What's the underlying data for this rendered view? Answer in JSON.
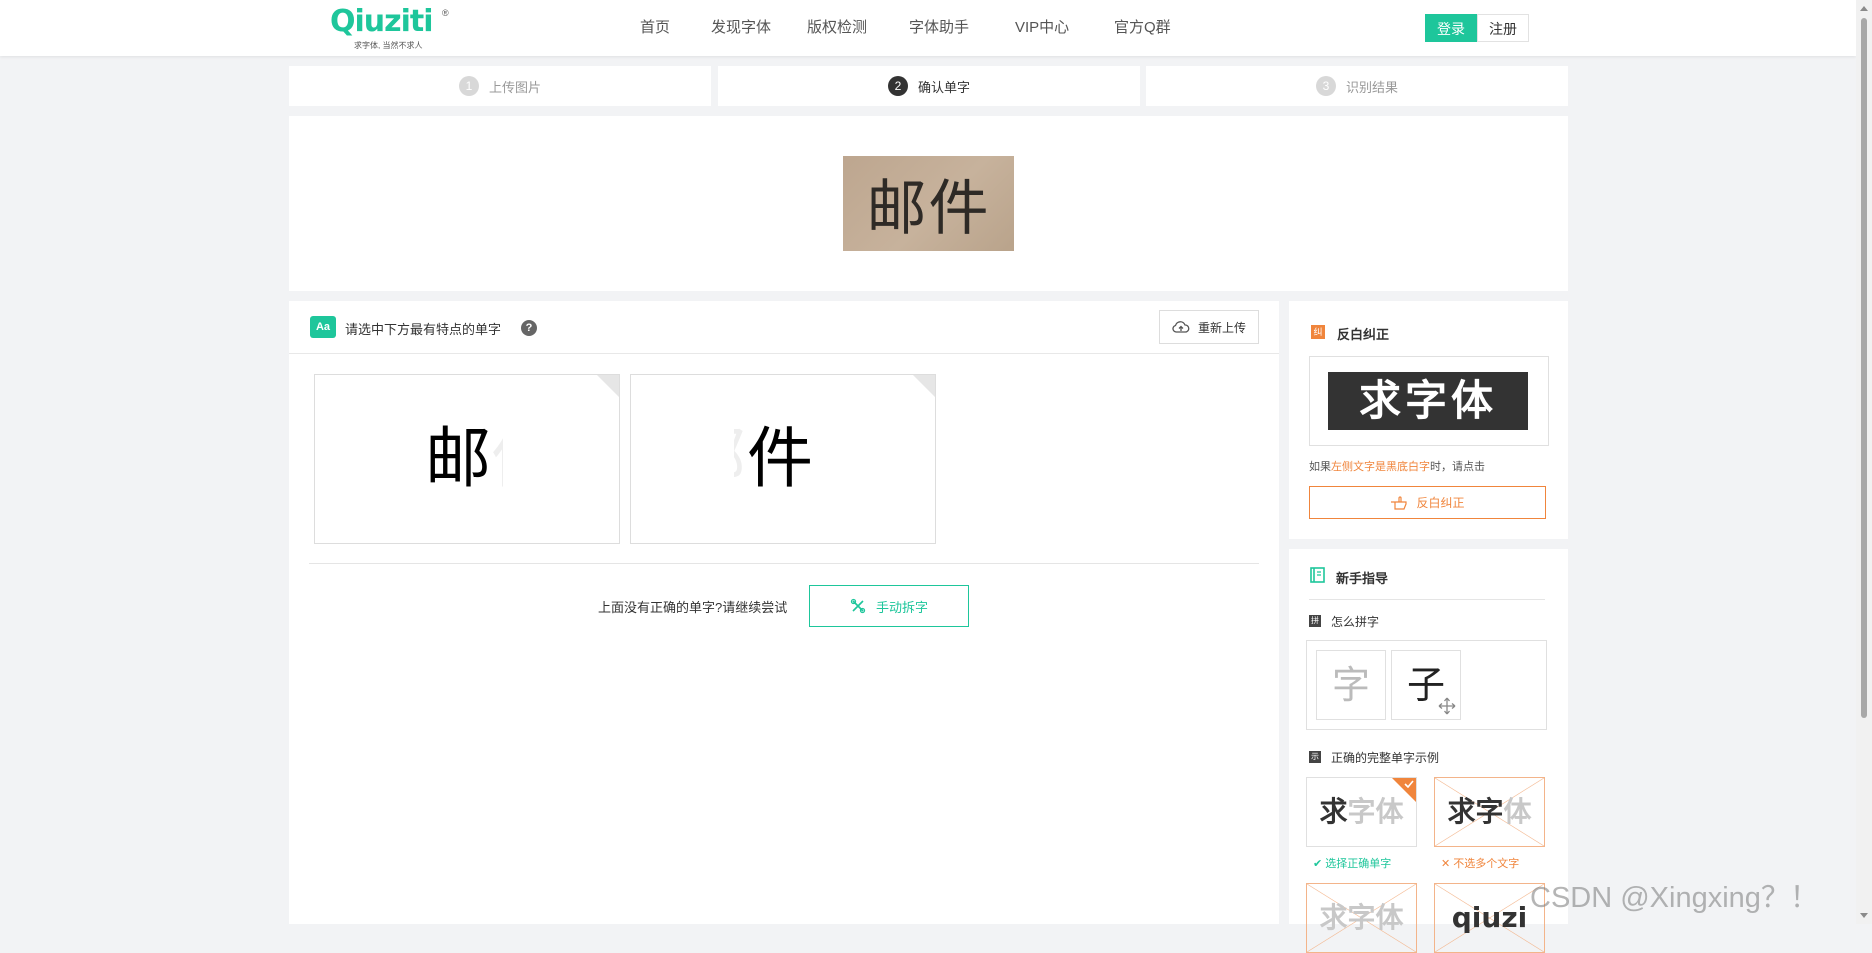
{
  "header": {
    "logo_text": "Qiuziti",
    "logo_mark": "®",
    "logo_tagline": "求字体, 当然不求人",
    "nav": [
      "首页",
      "发现字体",
      "版权检测",
      "字体助手",
      "VIP中心",
      "官方Q群"
    ],
    "login_label": "登录",
    "register_label": "注册"
  },
  "steps": [
    {
      "num": "1",
      "label": "上传图片"
    },
    {
      "num": "2",
      "label": "确认单字"
    },
    {
      "num": "3",
      "label": "识别结果"
    }
  ],
  "preview": {
    "text": "邮件"
  },
  "selection": {
    "icon_text": "Aa",
    "title": "请选中下方最有特点的单字",
    "help_text": "?",
    "reupload_label": "重新上传",
    "chars": [
      "邮",
      "件"
    ],
    "retry_text": "上面没有正确的单字?请继续尝试",
    "manual_label": "手动拆字"
  },
  "correction": {
    "icon_text": "纠",
    "title": "反白纠正",
    "demo_text": "求字体",
    "hint_prefix": "如果",
    "hint_highlight": "左侧文字是黑底白字",
    "hint_suffix": "时，请点击",
    "button_label": "反白纠正"
  },
  "guide": {
    "title": "新手指导",
    "howto_icon": "拼",
    "howto_title": "怎么拼字",
    "howto_tiles": [
      "字",
      "子"
    ],
    "example_icon": "示",
    "example_title": "正确的完整单字示例",
    "examples": [
      {
        "main": "求",
        "rest": "字体"
      },
      {
        "main": "求字",
        "rest": "体"
      },
      {
        "main": "求字",
        "rest": "体"
      },
      {
        "main": "qiuzi",
        "rest": ""
      }
    ],
    "good_label": "选择正确单字",
    "bad_label": "不选多个文字"
  },
  "watermark": "CSDN @Xingxing？！",
  "colors": {
    "brand": "#1ec69b",
    "accent_orange": "#f0853c",
    "background": "#f2f3f5"
  }
}
